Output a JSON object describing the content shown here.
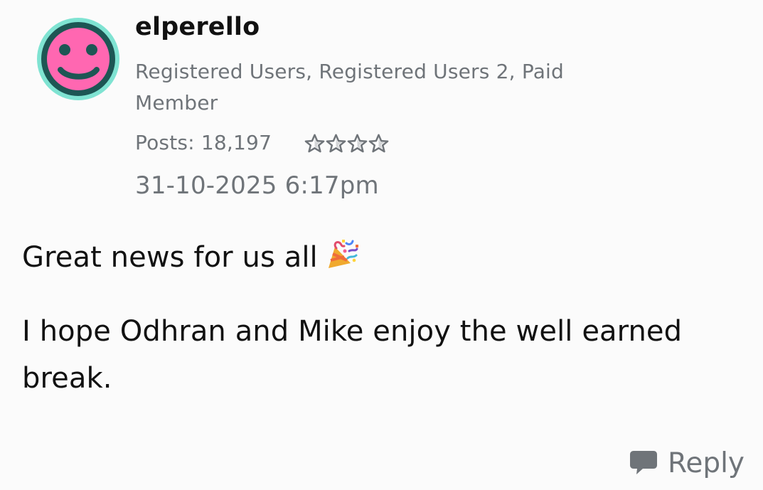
{
  "post": {
    "author": {
      "name": "elperello",
      "avatar_icon": "smiley-avatar-icon",
      "roles_line1": "Registered Users, Registered Users 2, Paid",
      "roles_line2": "Member",
      "posts_label": "Posts: 18,197",
      "rank_stars": 4,
      "rank_icon": "star-rank-icon"
    },
    "timestamp": "31-10-2025 6:17pm",
    "body": {
      "paragraph1": "Great news for us all",
      "paragraph1_icon": "party-popper-icon",
      "paragraph2": "I hope Odhran and Mike enjoy the well earned break."
    },
    "actions": {
      "reply_label": "Reply",
      "reply_icon": "speech-bubble-icon"
    }
  },
  "colors": {
    "avatar_ring": "#7fe3d2",
    "avatar_face": "#ff67b1",
    "avatar_features": "#1d5654",
    "text_primary": "#111111",
    "text_secondary": "#6f7479",
    "star_fill": "#ffffff",
    "star_stroke": "#6f7479",
    "background": "#fbfbfb"
  }
}
